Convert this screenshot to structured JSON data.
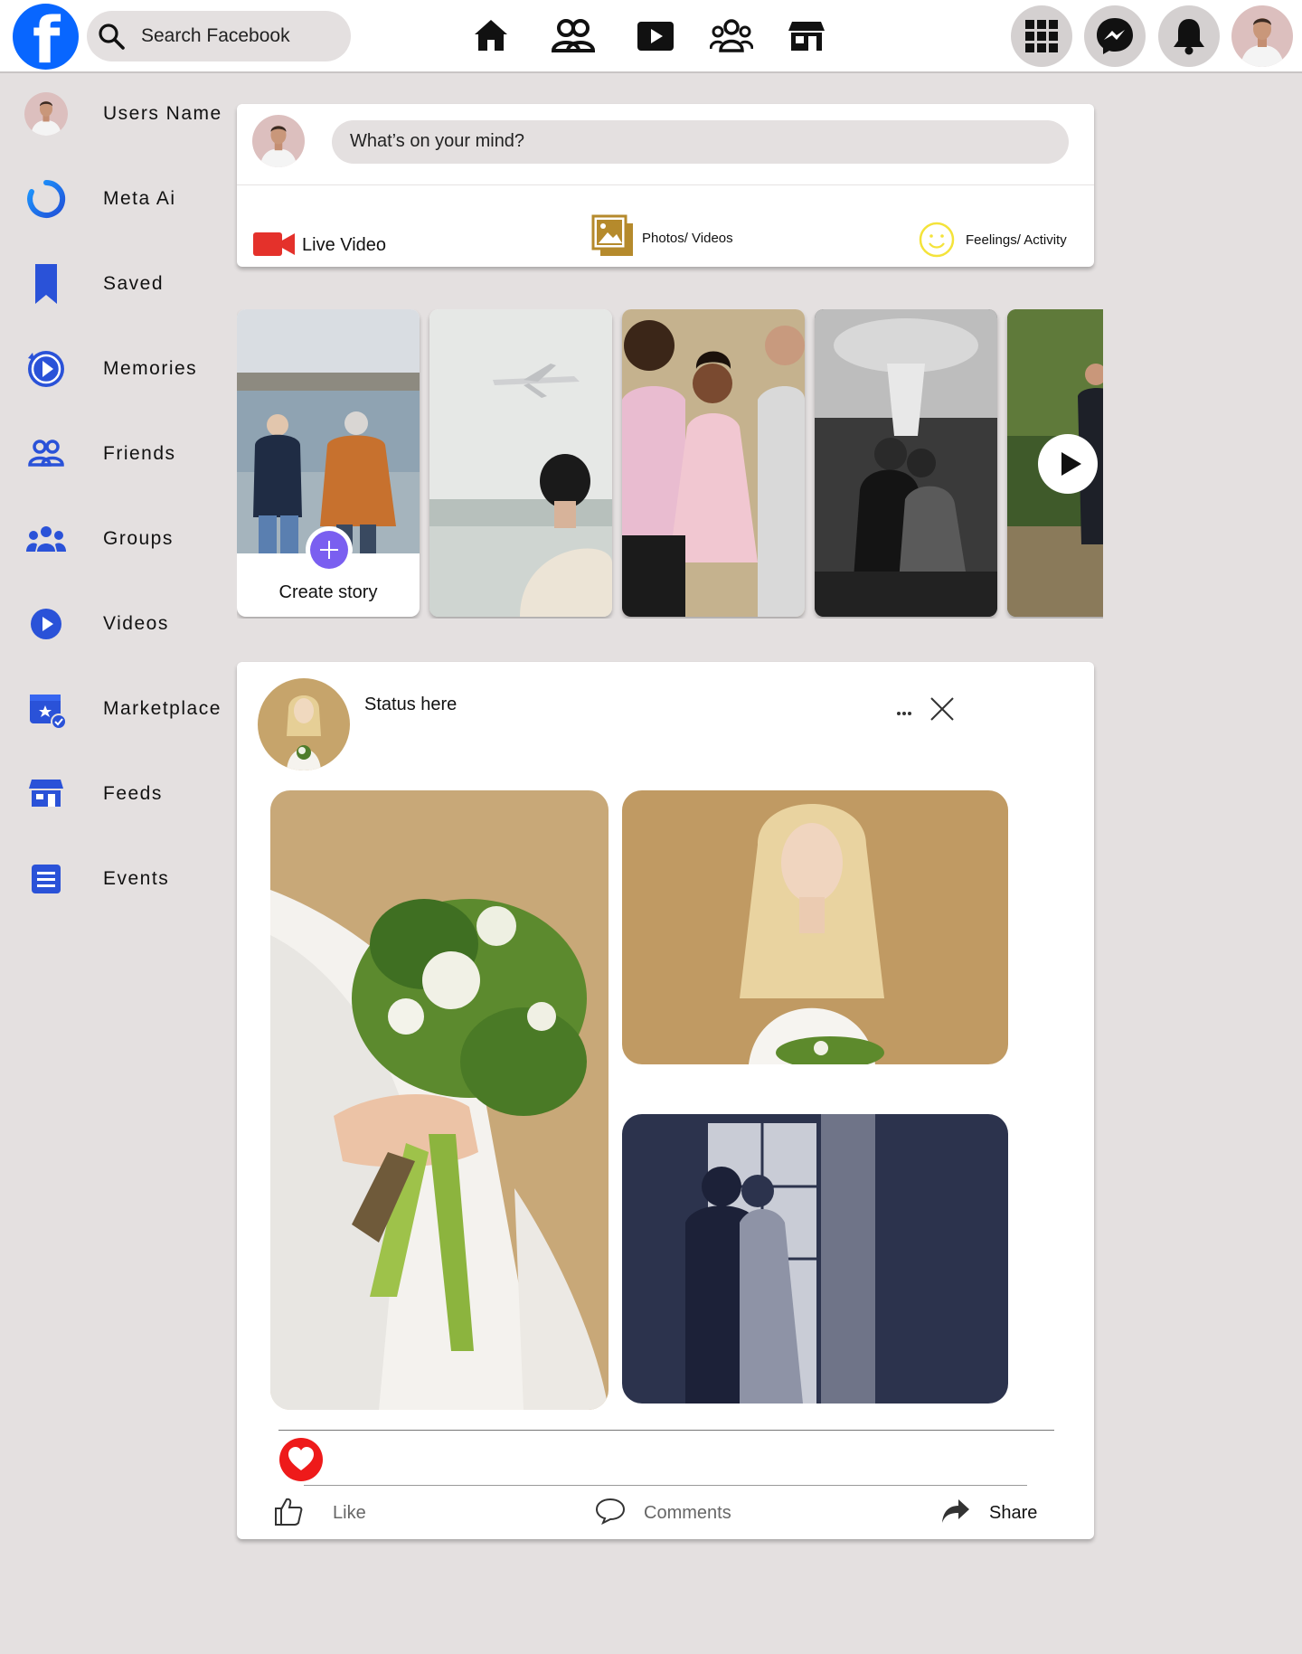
{
  "header": {
    "logo": "facebook-logo",
    "search_placeholder": "Search Facebook",
    "nav_icons": [
      "home-icon",
      "friends-icon",
      "video-icon",
      "groups-icon",
      "marketplace-icon"
    ],
    "right_icons": [
      "menu-grid-icon",
      "messenger-icon",
      "bell-icon"
    ]
  },
  "sidebar": {
    "items": [
      {
        "label": "Users Name",
        "icon": "avatar"
      },
      {
        "label": "Meta Ai",
        "icon": "meta-ai-icon"
      },
      {
        "label": "Saved",
        "icon": "bookmark-icon"
      },
      {
        "label": "Memories",
        "icon": "memories-icon"
      },
      {
        "label": "Friends",
        "icon": "friends-icon"
      },
      {
        "label": "Groups",
        "icon": "groups-icon"
      },
      {
        "label": "Videos",
        "icon": "video-icon"
      },
      {
        "label": "Marketplace",
        "icon": "marketplace-icon"
      },
      {
        "label": "Feeds",
        "icon": "feeds-icon"
      },
      {
        "label": "Events",
        "icon": "events-icon"
      }
    ]
  },
  "composer": {
    "placeholder": "What’s on your mind?",
    "live_video": "Live Video",
    "photos_videos": "Photos/ Videos",
    "feelings": "Feelings/ Activity"
  },
  "stories": {
    "create_label": "Create story"
  },
  "post": {
    "status": "Status here",
    "like": "Like",
    "comments": "Comments",
    "share": "Share"
  },
  "colors": {
    "brand": "#0866ff",
    "sidebar_icon": "#2a52d8",
    "page_bg": "#e4e0e0",
    "live_red": "#e4312b",
    "photos_gold": "#b58a2c",
    "feelings_yellow": "#f4e33a",
    "create_story_purple": "#7a5ff0",
    "heart_red": "#ee1a1a"
  }
}
